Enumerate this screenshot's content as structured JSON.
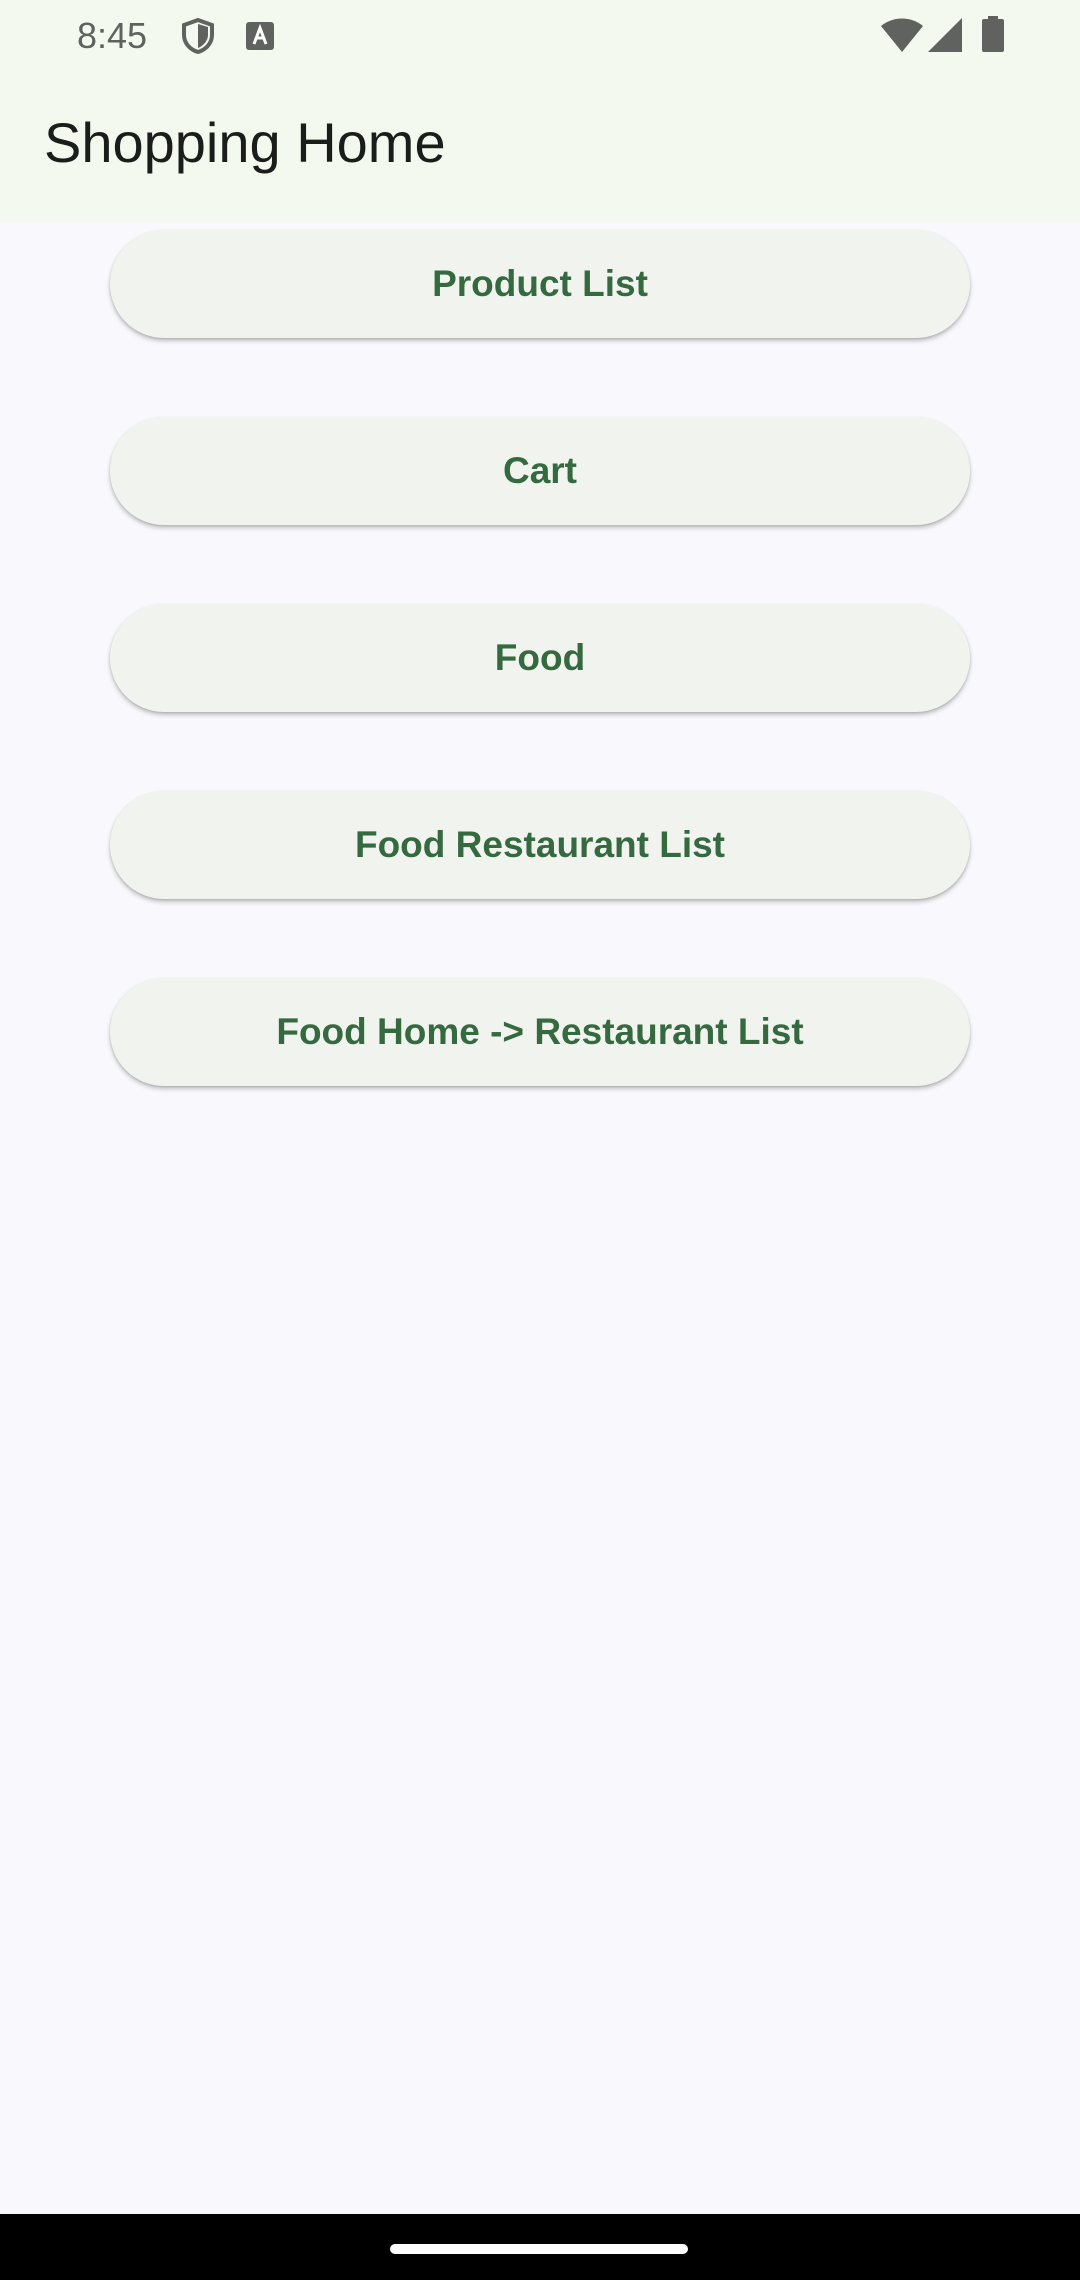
{
  "status_bar": {
    "time": "8:45",
    "icons": [
      "shield-icon",
      "text-a-icon",
      "wifi-icon",
      "signal-icon",
      "battery-icon"
    ]
  },
  "app_bar": {
    "title": "Shopping Home"
  },
  "buttons": [
    {
      "label": "Product List"
    },
    {
      "label": "Cart"
    },
    {
      "label": "Food"
    },
    {
      "label": "Food Restaurant List"
    },
    {
      "label": "Food Home -> Restaurant List"
    }
  ],
  "colors": {
    "app_bar_background": "#F3F9EF",
    "page_background": "#F9F9FD",
    "button_background": "#F1F4EE",
    "button_text": "#35693F",
    "title_text": "#1B1D1A"
  }
}
